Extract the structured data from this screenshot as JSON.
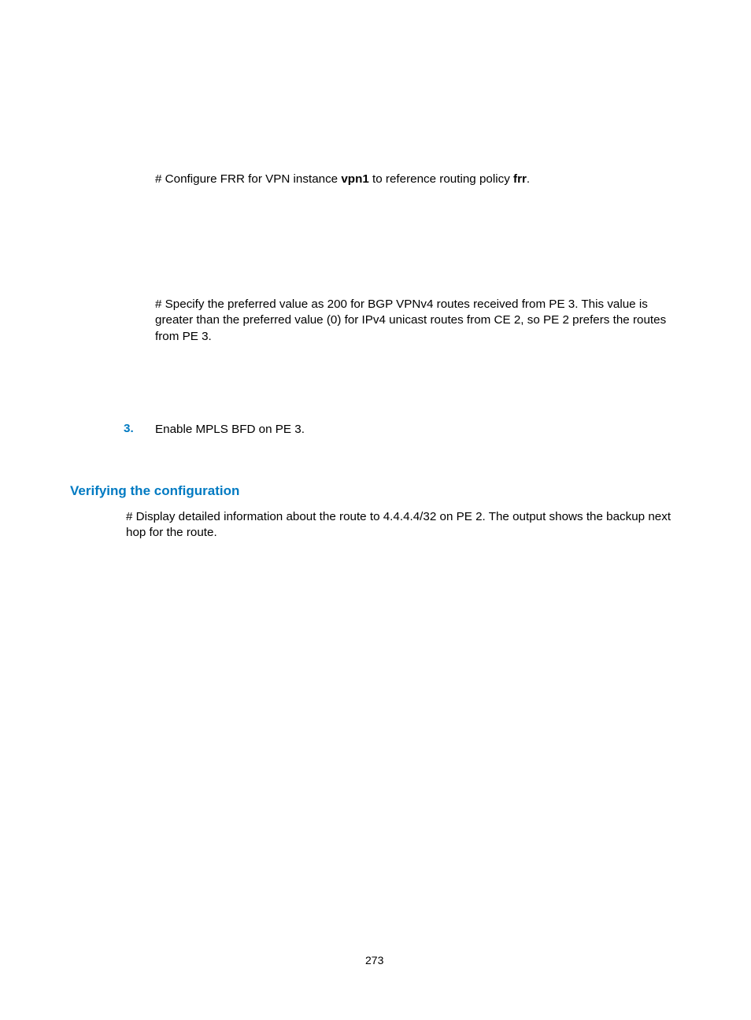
{
  "para1_pre": "# Configure FRR for VPN instance ",
  "para1_b1": "vpn1",
  "para1_mid": " to reference routing policy ",
  "para1_b2": "frr",
  "para1_post": ".",
  "para2": "# Specify the preferred value as 200 for BGP VPNv4 routes received from PE 3. This value is greater than the preferred value (0) for IPv4 unicast routes from CE 2, so PE 2 prefers the routes from PE 3.",
  "step_num": "3.",
  "step_text": "Enable MPLS BFD on PE 3.",
  "heading": "Verifying the configuration",
  "para3": "# Display detailed information about the route to 4.4.4.4/32 on PE 2. The output shows the backup next hop for the route.",
  "page_number": "273"
}
